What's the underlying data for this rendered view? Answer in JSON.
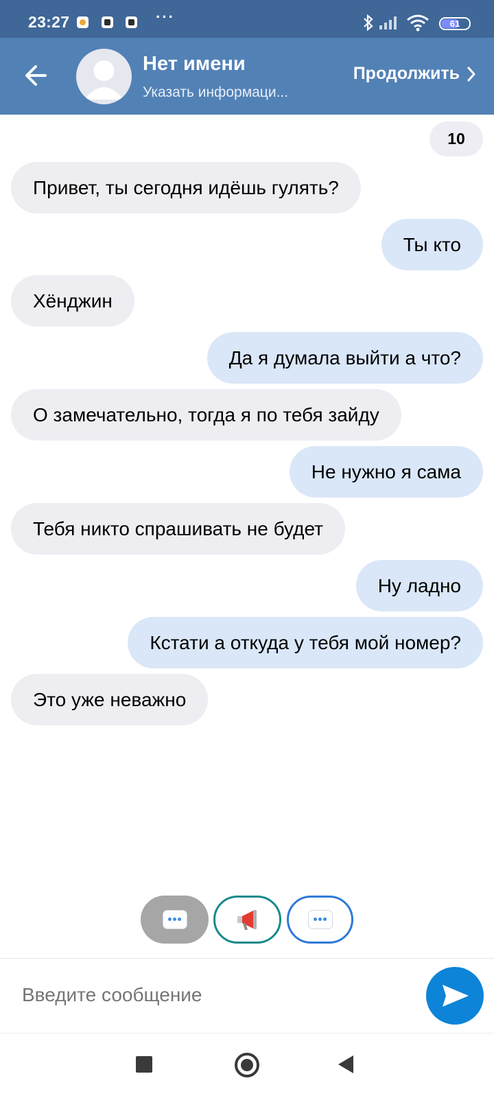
{
  "status_bar": {
    "time": "23:27",
    "notification_icons": [
      "app-notification-icon",
      "app-notification-icon",
      "app-notification-icon"
    ],
    "overflow": "···",
    "system_icons": [
      "bluetooth-icon",
      "signal-icon",
      "wifi-icon"
    ],
    "battery_percent": 61,
    "battery_label": "61"
  },
  "header": {
    "back_icon": "arrow-left-icon",
    "avatar_icon": "person-placeholder-icon",
    "title": "Нет имени",
    "subtitle": "Указать информаци...",
    "continue_label": "Продолжить",
    "continue_icon": "chevron-right-icon"
  },
  "chat": {
    "counter": "10",
    "messages": [
      {
        "side": "in",
        "text": "Привет, ты сегодня идёшь гулять?"
      },
      {
        "side": "out",
        "text": "Ты кто"
      },
      {
        "side": "in",
        "text": "Хёнджин"
      },
      {
        "side": "out",
        "text": "Да я думала выйти а что?"
      },
      {
        "side": "in",
        "text": "О замечательно, тогда я по тебя зайду"
      },
      {
        "side": "out",
        "text": "Не нужно я сама"
      },
      {
        "side": "in",
        "text": "Тебя никто спрашивать не будет"
      },
      {
        "side": "out",
        "text": "Ну ладно"
      },
      {
        "side": "out",
        "text": "Кстати а откуда у тебя мой номер?"
      },
      {
        "side": "in",
        "text": "Это уже неважно"
      }
    ]
  },
  "quick_actions": [
    {
      "icon": "speech-bubble-icon",
      "state": "selected",
      "color": "#a6a6a6"
    },
    {
      "icon": "megaphone-icon",
      "state": "outlined",
      "color": "#19898a"
    },
    {
      "icon": "speech-bubble-icon",
      "state": "outlined",
      "color": "#2e7ad8"
    }
  ],
  "composer": {
    "placeholder": "Введите сообщение",
    "send_icon": "send-icon"
  },
  "nav_bar": [
    "recents-square-icon",
    "home-circle-icon",
    "back-triangle-icon"
  ],
  "colors": {
    "status_bar": "#3f6798",
    "header": "#5281b6",
    "incoming_bubble": "#eeedf2",
    "outgoing_bubble": "#dae7f8",
    "send_button": "#0d84d8"
  }
}
